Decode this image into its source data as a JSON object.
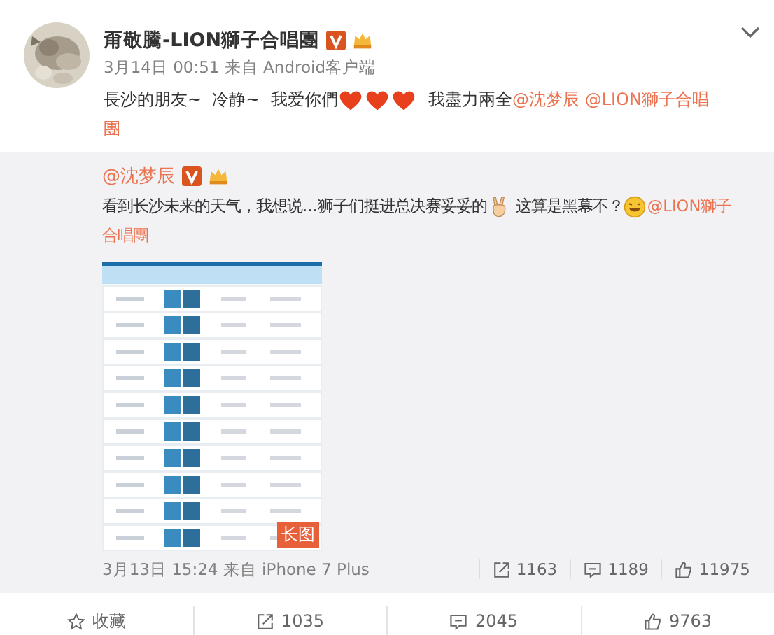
{
  "post": {
    "author": "甭敬騰-LION獅子合唱團",
    "badges": [
      {
        "kind": "verified"
      },
      {
        "kind": "vip"
      }
    ],
    "meta": "3月14日 00:51 来自 Android客户端",
    "lines": [
      [
        {
          "kind": "text",
          "text": "長沙的朋友~  冷静~  我爱你們"
        },
        {
          "kind": "heart"
        },
        {
          "kind": "heart"
        },
        {
          "kind": "heart"
        },
        {
          "kind": "text",
          "text": "  我盡力兩全"
        },
        {
          "kind": "mention",
          "text": "@沈梦辰"
        },
        {
          "kind": "mention",
          "text": " @LION獅子合唱"
        }
      ],
      [
        {
          "kind": "mention",
          "text": "團"
        }
      ]
    ]
  },
  "repost": {
    "author": "@沈梦辰",
    "badges": [
      {
        "kind": "verified"
      },
      {
        "kind": "vip"
      }
    ],
    "lines": [
      [
        {
          "kind": "text",
          "text": "看到长沙未来的天气，我想说...狮子们挺进总决赛妥妥的"
        },
        {
          "kind": "victory"
        },
        {
          "kind": "text",
          "text": " 这算是黑幕不？"
        },
        {
          "kind": "grin"
        },
        {
          "kind": "mention",
          "text": "@LION獅子"
        }
      ],
      [
        {
          "kind": "mention",
          "text": "合唱團"
        }
      ]
    ],
    "image": {
      "kind": "picture",
      "badge": "长图"
    },
    "meta": "3月13日 15:24 来自 iPhone 7 Plus",
    "stats": [
      {
        "kind": "repost",
        "count": "1163"
      },
      {
        "kind": "comment",
        "count": "1189"
      },
      {
        "kind": "like",
        "count": "11975"
      }
    ]
  },
  "actions": [
    {
      "kind": "favorite",
      "label": "收藏"
    },
    {
      "kind": "repost",
      "label": "1035"
    },
    {
      "kind": "comment",
      "label": "2045"
    },
    {
      "kind": "like",
      "label": "9763"
    }
  ]
}
